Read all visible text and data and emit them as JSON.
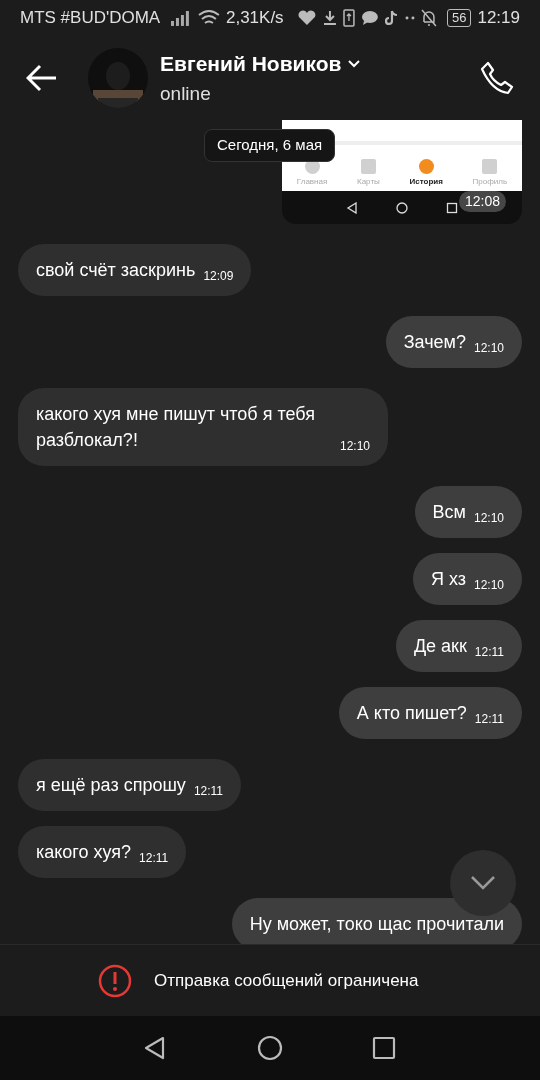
{
  "status_bar": {
    "carrier": "MTS #BUD'DOMA",
    "speed": "2,31K/s",
    "battery": "56",
    "time": "12:19"
  },
  "header": {
    "name": "Евгений Новиков",
    "status": "online"
  },
  "date_label": "Сегодня, 6 мая",
  "messages": [
    {
      "kind": "image",
      "outgoing": true,
      "time": "12:08",
      "nav_items": [
        {
          "label": "Главная",
          "selected": false
        },
        {
          "label": "Карты",
          "selected": false
        },
        {
          "label": "История",
          "selected": true
        },
        {
          "label": "Профиль",
          "selected": false
        }
      ]
    },
    {
      "kind": "text",
      "outgoing": false,
      "text": "свой счёт заскринь",
      "time": "12:09"
    },
    {
      "kind": "text",
      "outgoing": true,
      "text": "Зачем?",
      "time": "12:10"
    },
    {
      "kind": "text",
      "outgoing": false,
      "text": "какого хуя мне пишут чтоб я тебя разблокал?!",
      "time": "12:10"
    },
    {
      "kind": "text",
      "outgoing": true,
      "text": "Всм",
      "time": "12:10"
    },
    {
      "kind": "text",
      "outgoing": true,
      "text": "Я хз",
      "time": "12:10"
    },
    {
      "kind": "text",
      "outgoing": true,
      "text": "Де акк",
      "time": "12:11"
    },
    {
      "kind": "text",
      "outgoing": true,
      "text": "А кто пишет?",
      "time": "12:11"
    },
    {
      "kind": "text",
      "outgoing": false,
      "text": "я ещё раз спрошу",
      "time": "12:11"
    },
    {
      "kind": "text",
      "outgoing": false,
      "text": "какого хуя?",
      "time": "12:11"
    },
    {
      "kind": "text",
      "outgoing": true,
      "text": "Ну может, токо щас прочитали"
    }
  ],
  "notice": "Отправка сообщений ограничена"
}
